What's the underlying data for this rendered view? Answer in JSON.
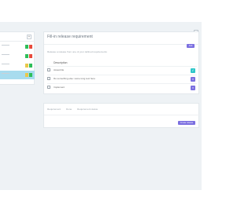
{
  "colors": {
    "accent_purple": "#7b6fe0",
    "accent_teal": "#2ec6c9",
    "active_row": "#a8dcee",
    "page_background": "#eef2f5"
  },
  "left_panel": {
    "rows": [
      {
        "swatches": [
          "#2ebf5a",
          "#e84a3c"
        ],
        "active": false
      },
      {
        "swatches": [
          "#2ebf5a",
          "#e84a3c"
        ],
        "active": false
      },
      {
        "swatches": [
          "#e9c84a",
          "#2ebf5a"
        ],
        "active": false
      },
      {
        "swatches": [
          "#e9c84a",
          "#2ebf5a"
        ],
        "active": true
      }
    ]
  },
  "main_card": {
    "title": "Fill-in release requirement",
    "description": "Release a release from one of your defined requirements",
    "add_button_label": "Add",
    "column_header": "Description",
    "rows": [
      {
        "text": "Assemble",
        "action_icon": "check-icon",
        "action_color": "teal"
      },
      {
        "text": "Do something else: some long text here",
        "action_icon": "x-icon",
        "action_color": "purple"
      },
      {
        "text": "Implement",
        "action_icon": "x-icon",
        "action_color": "purple"
      }
    ]
  },
  "second_card": {
    "filters": [
      "Requirement",
      "Done",
      "Requirement status"
    ],
    "button_label": "Create release"
  }
}
